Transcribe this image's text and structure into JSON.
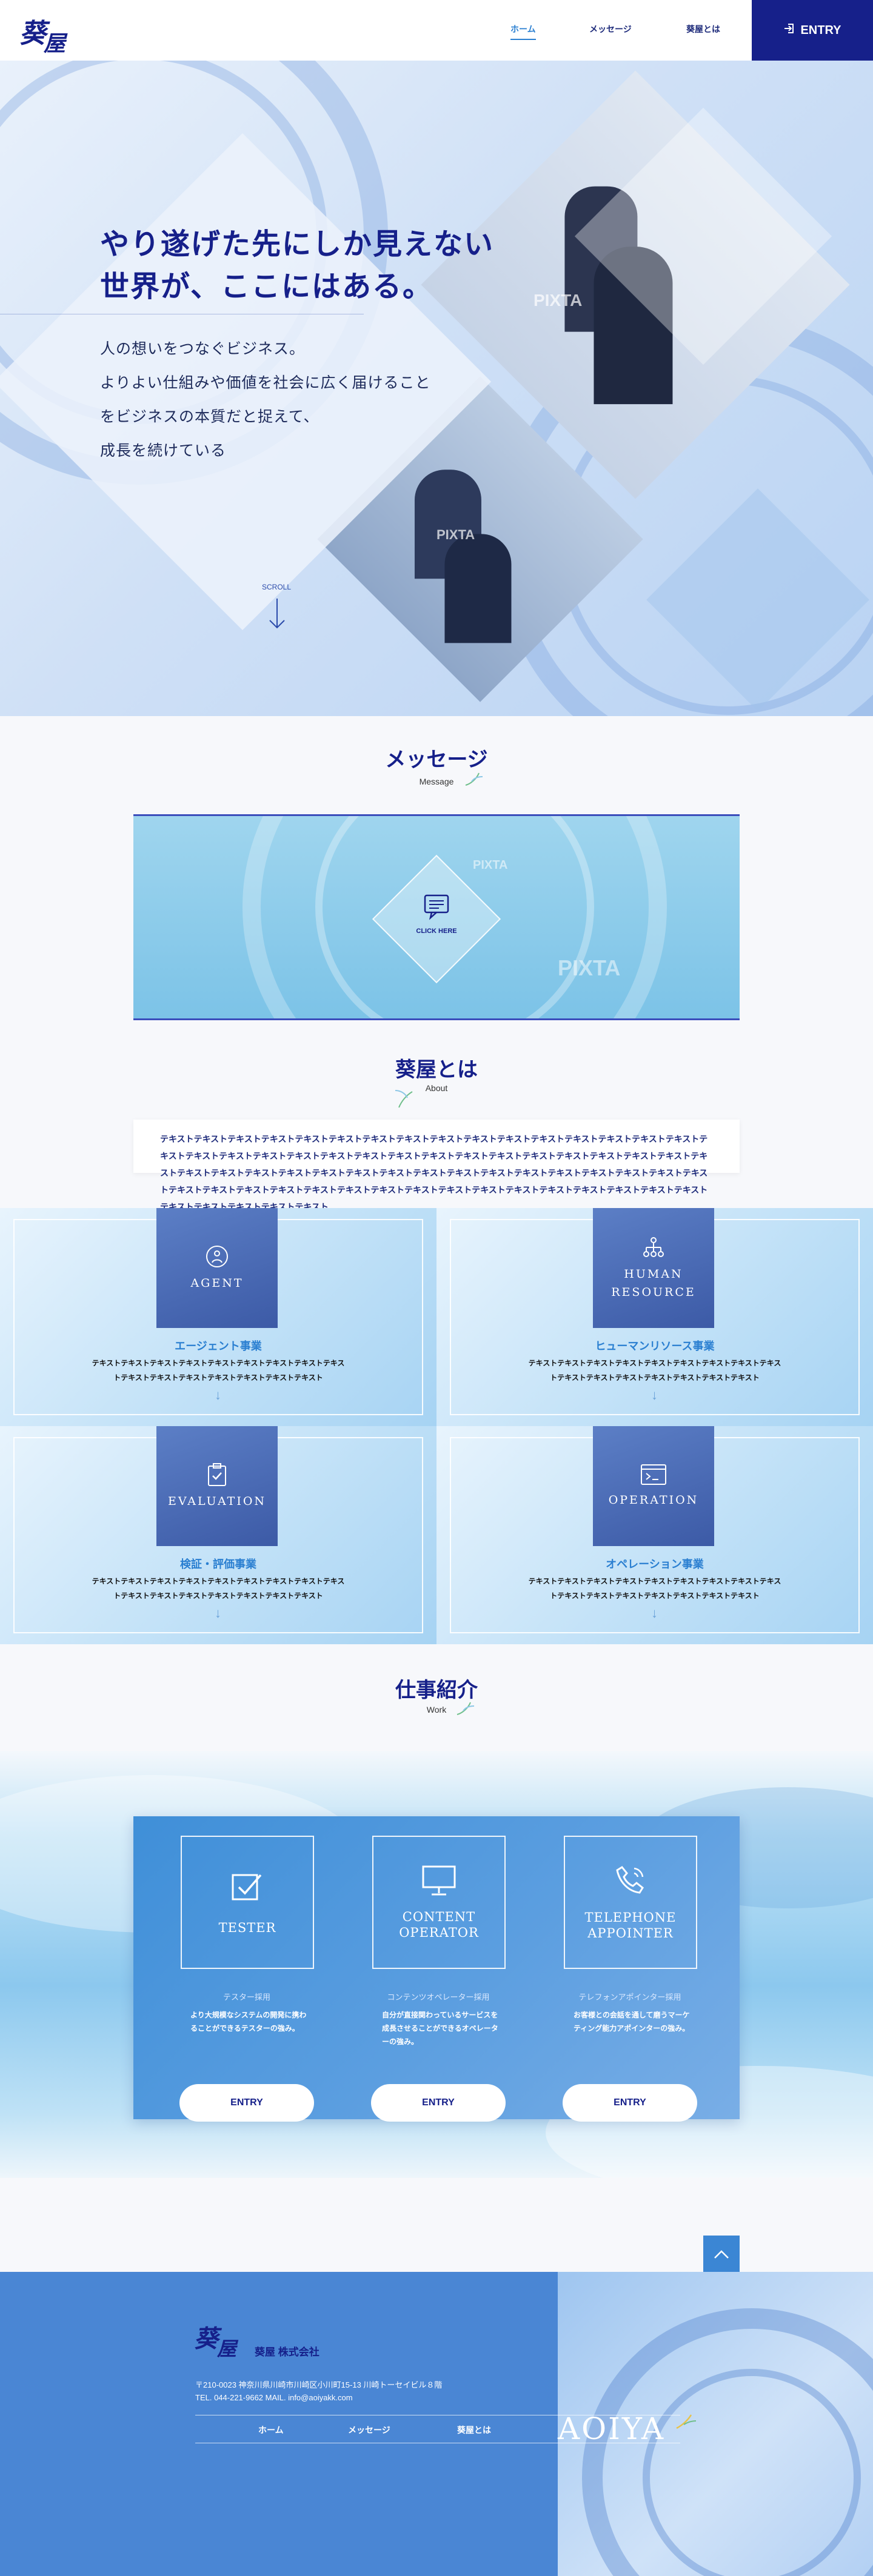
{
  "header": {
    "logo_text": "葵屋",
    "nav": [
      {
        "label": "ホーム",
        "active": true
      },
      {
        "label": "メッセージ",
        "active": false
      },
      {
        "label": "葵屋とは",
        "active": false
      }
    ],
    "entry_label": "ENTRY"
  },
  "hero": {
    "title_line1": "やり遂げた先にしか見えない",
    "title_line2": "世界が、ここにはある。",
    "lines": [
      "人の想いをつなぐビジネス。",
      "よりよい仕組みや価値を社会に広く届けること",
      "をビジネスの本質だと捉えて、",
      "成長を続けている"
    ],
    "scroll_label": "SCROLL",
    "watermark": "PIXTA"
  },
  "message": {
    "title": "メッセージ",
    "subtitle": "Message",
    "banner_button": "CLICK HERE",
    "watermark": "PIXTA"
  },
  "about": {
    "title": "葵屋とは",
    "subtitle": "About",
    "text": "テキストテキストテキストテキストテキストテキストテキストテキストテキストテキストテキストテキストテキストテキストテキストテキストテキストテキストテキストテキストテキストテキストテキストテキストテキストテキストテキストテキストテキストテキストテキストテキストテキストテキストテキストテキストテキストテキストテキストテキストテキストテキストテキストテキストテキストテキストテキストテキストテキストテキストテキストテキストテキストテキストテキストテキストテキストテキストテキストテキストテキストテキストテキストテキストテキストテキストテキストテキストテキストテキスト"
  },
  "business": [
    {
      "icon": "people-network-icon",
      "photo_label": "AGENT",
      "title": "エージェント事業",
      "text": "テキストテキストテキストテキストテキストテキストテキストテキストテキストテキストテキストテキストテキストテキストテキストテキスト"
    },
    {
      "icon": "org-chart-icon",
      "photo_label": "HUMAN RESOURCE",
      "title": "ヒューマンリソース事業",
      "text": "テキストテキストテキストテキストテキストテキストテキストテキストテキストテキストテキストテキストテキストテキストテキストテキスト"
    },
    {
      "icon": "clipboard-check-icon",
      "photo_label": "EVALUATION",
      "title": "検証・評価事業",
      "text": "テキストテキストテキストテキストテキストテキストテキストテキストテキストテキストテキストテキストテキストテキストテキストテキスト"
    },
    {
      "icon": "terminal-window-icon",
      "photo_label": "OPERATION",
      "title": "オペレーション事業",
      "text": "テキストテキストテキストテキストテキストテキストテキストテキストテキストテキストテキストテキストテキストテキストテキストテキスト"
    }
  ],
  "work": {
    "title": "仕事紹介",
    "subtitle": "Work",
    "jobs": [
      {
        "icon": "checkbox-icon",
        "label": "TESTER",
        "category": "テスター採用",
        "description": "より大規模なシステムの開発に携わることができるテスターの強み。",
        "entry": "ENTRY"
      },
      {
        "icon": "monitor-icon",
        "label": "CONTENT OPERATOR",
        "category": "コンテンツオペレーター採用",
        "description": "自分が直接関わっているサービスを成長させることができるオペレーターの強み。",
        "entry": "ENTRY"
      },
      {
        "icon": "phone-icon",
        "label": "TELEPHONE APPOINTER",
        "category": "テレフォンアポインター採用",
        "description": "お客様との会話を通して磨うマーケティング能力アポインターの強み。",
        "entry": "ENTRY"
      }
    ]
  },
  "footer": {
    "logo_text": "葵屋",
    "company": "葵屋 株式会社",
    "address": "〒210-0023 神奈川県川崎市川崎区小川町15-13 川崎トーセイビル８階",
    "contact": "TEL. 044-221-9662 MAIL. info@aoiyakk.com",
    "nav": [
      "ホーム",
      "メッセージ",
      "葵屋とは"
    ],
    "brand": "AOIYA"
  },
  "colors": {
    "navy": "#16208a",
    "accent_blue": "#2a7fd1",
    "footer_blue": "#4a86d4"
  }
}
